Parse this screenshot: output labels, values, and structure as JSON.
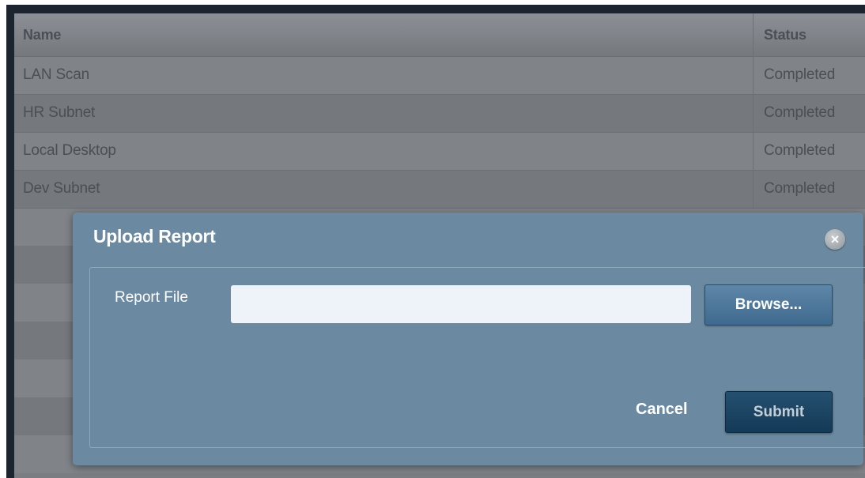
{
  "table": {
    "columns": {
      "name": "Name",
      "status": "Status"
    },
    "rows": [
      {
        "name": "LAN Scan",
        "status": "Completed"
      },
      {
        "name": "HR Subnet",
        "status": "Completed"
      },
      {
        "name": "Local Desktop",
        "status": "Completed"
      },
      {
        "name": "Dev Subnet",
        "status": "Completed"
      }
    ]
  },
  "modal": {
    "title": "Upload Report",
    "close_icon": "close-icon",
    "file_label": "Report File",
    "file_value": "",
    "browse_label": "Browse...",
    "cancel_label": "Cancel",
    "submit_label": "Submit"
  }
}
